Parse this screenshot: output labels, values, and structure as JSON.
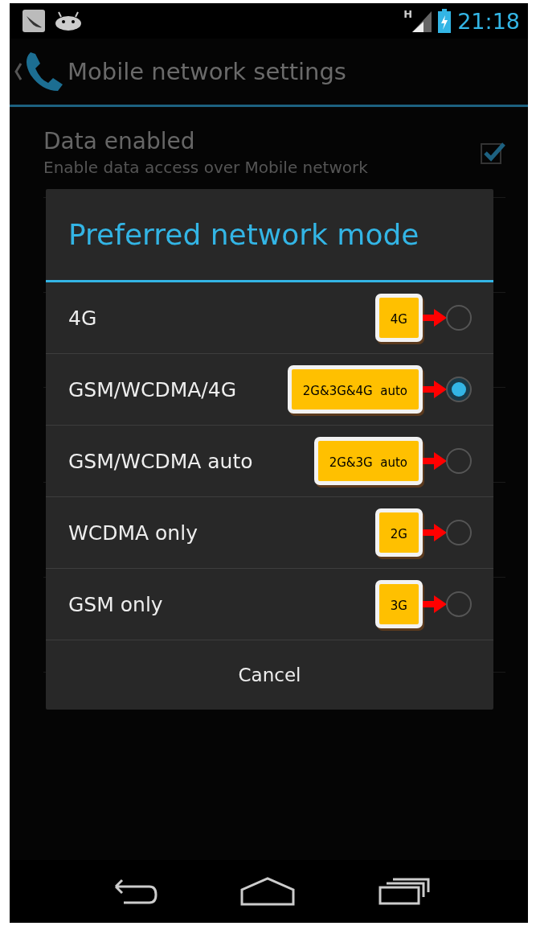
{
  "status_bar": {
    "time": "21:18",
    "network_type": "H"
  },
  "action_bar": {
    "title": "Mobile network settings"
  },
  "settings": [
    {
      "title": "Data enabled",
      "summary": "Enable data access over Mobile network",
      "checked": true
    }
  ],
  "dialog": {
    "title": "Preferred network mode",
    "options": [
      {
        "label": "4G",
        "selected": false,
        "callout": "4G"
      },
      {
        "label": "GSM/WCDMA/4G",
        "selected": true,
        "callout": "2G&3G&4G  auto"
      },
      {
        "label": "GSM/WCDMA auto",
        "selected": false,
        "callout": "2G&3G  auto"
      },
      {
        "label": "WCDMA only",
        "selected": false,
        "callout": "2G"
      },
      {
        "label": "GSM only",
        "selected": false,
        "callout": "3G"
      }
    ],
    "cancel": "Cancel"
  }
}
